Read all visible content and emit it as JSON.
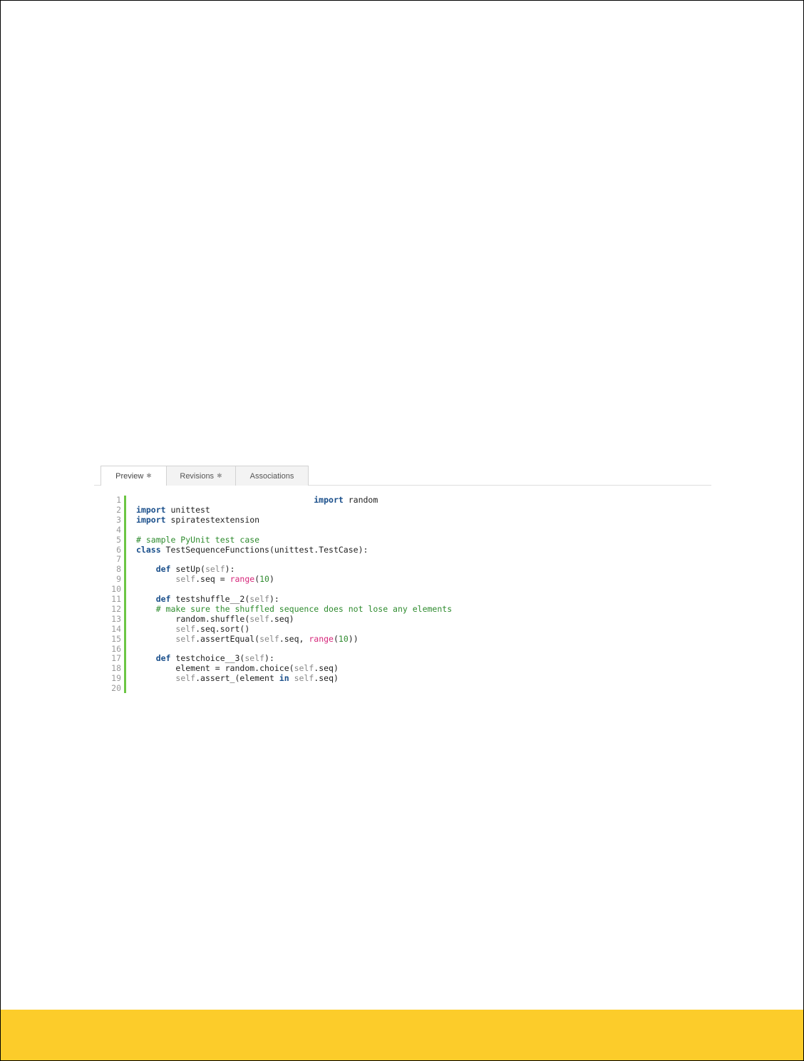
{
  "tabs": [
    {
      "label": "Preview",
      "icon": "gear-icon",
      "active": true
    },
    {
      "label": "Revisions",
      "icon": "gear-icon",
      "active": false
    },
    {
      "label": "Associations",
      "icon": "",
      "active": false
    }
  ],
  "code": {
    "line_numbers": [
      "1",
      "2",
      "3",
      "4",
      "5",
      "6",
      "7",
      "8",
      "9",
      "10",
      "11",
      "12",
      "13",
      "14",
      "15",
      "16",
      "17",
      "18",
      "19",
      "20"
    ],
    "lines": [
      {
        "indent": "                                    ",
        "k1": "import",
        "t1": " random"
      },
      {
        "k1": "import",
        "t1": " unittest"
      },
      {
        "k1": "import",
        "t1": " spiratestextension"
      },
      {
        "t1": ""
      },
      {
        "c1": "# sample PyUnit test case"
      },
      {
        "k1": "class",
        "t1": " TestSequenceFunctions(unittest.TestCase):"
      },
      {
        "t1": ""
      },
      {
        "indent": "    ",
        "k1": "def",
        "t1": " setUp(",
        "s1": "self",
        "t2": "):"
      },
      {
        "indent": "        ",
        "s1": "self",
        "t1": ".seq = ",
        "f1": "range",
        "t2": "(",
        "n1": "10",
        "t3": ")"
      },
      {
        "t1": ""
      },
      {
        "indent": "    ",
        "k1": "def",
        "t1": " testshuffle__2(",
        "s1": "self",
        "t2": "):"
      },
      {
        "indent": "    ",
        "c1": "# make sure the shuffled sequence does not lose any elements"
      },
      {
        "indent": "        ",
        "t1": "random.shuffle(",
        "s1": "self",
        "t2": ".seq)"
      },
      {
        "indent": "        ",
        "s1": "self",
        "t1": ".seq.sort()"
      },
      {
        "indent": "        ",
        "s1": "self",
        "t1": ".assertEqual(",
        "s2": "self",
        "t2": ".seq, ",
        "f1": "range",
        "t3": "(",
        "n1": "10",
        "t4": "))"
      },
      {
        "t1": ""
      },
      {
        "indent": "    ",
        "k1": "def",
        "t1": " testchoice__3(",
        "s1": "self",
        "t2": "):"
      },
      {
        "indent": "        ",
        "t1": "element = random.choice(",
        "s1": "self",
        "t2": ".seq)"
      },
      {
        "indent": "        ",
        "s1": "self",
        "t1": ".assert_(element ",
        "k2": "in",
        "t2": " ",
        "s2": "self",
        "t3": ".seq)"
      },
      {
        "t1": ""
      }
    ]
  },
  "colors": {
    "accent_green": "#6cc644",
    "footer_yellow": "#fccc2a",
    "keyword": "#1a4f8b",
    "comment": "#2e8b2e",
    "builtin": "#d6267a"
  }
}
